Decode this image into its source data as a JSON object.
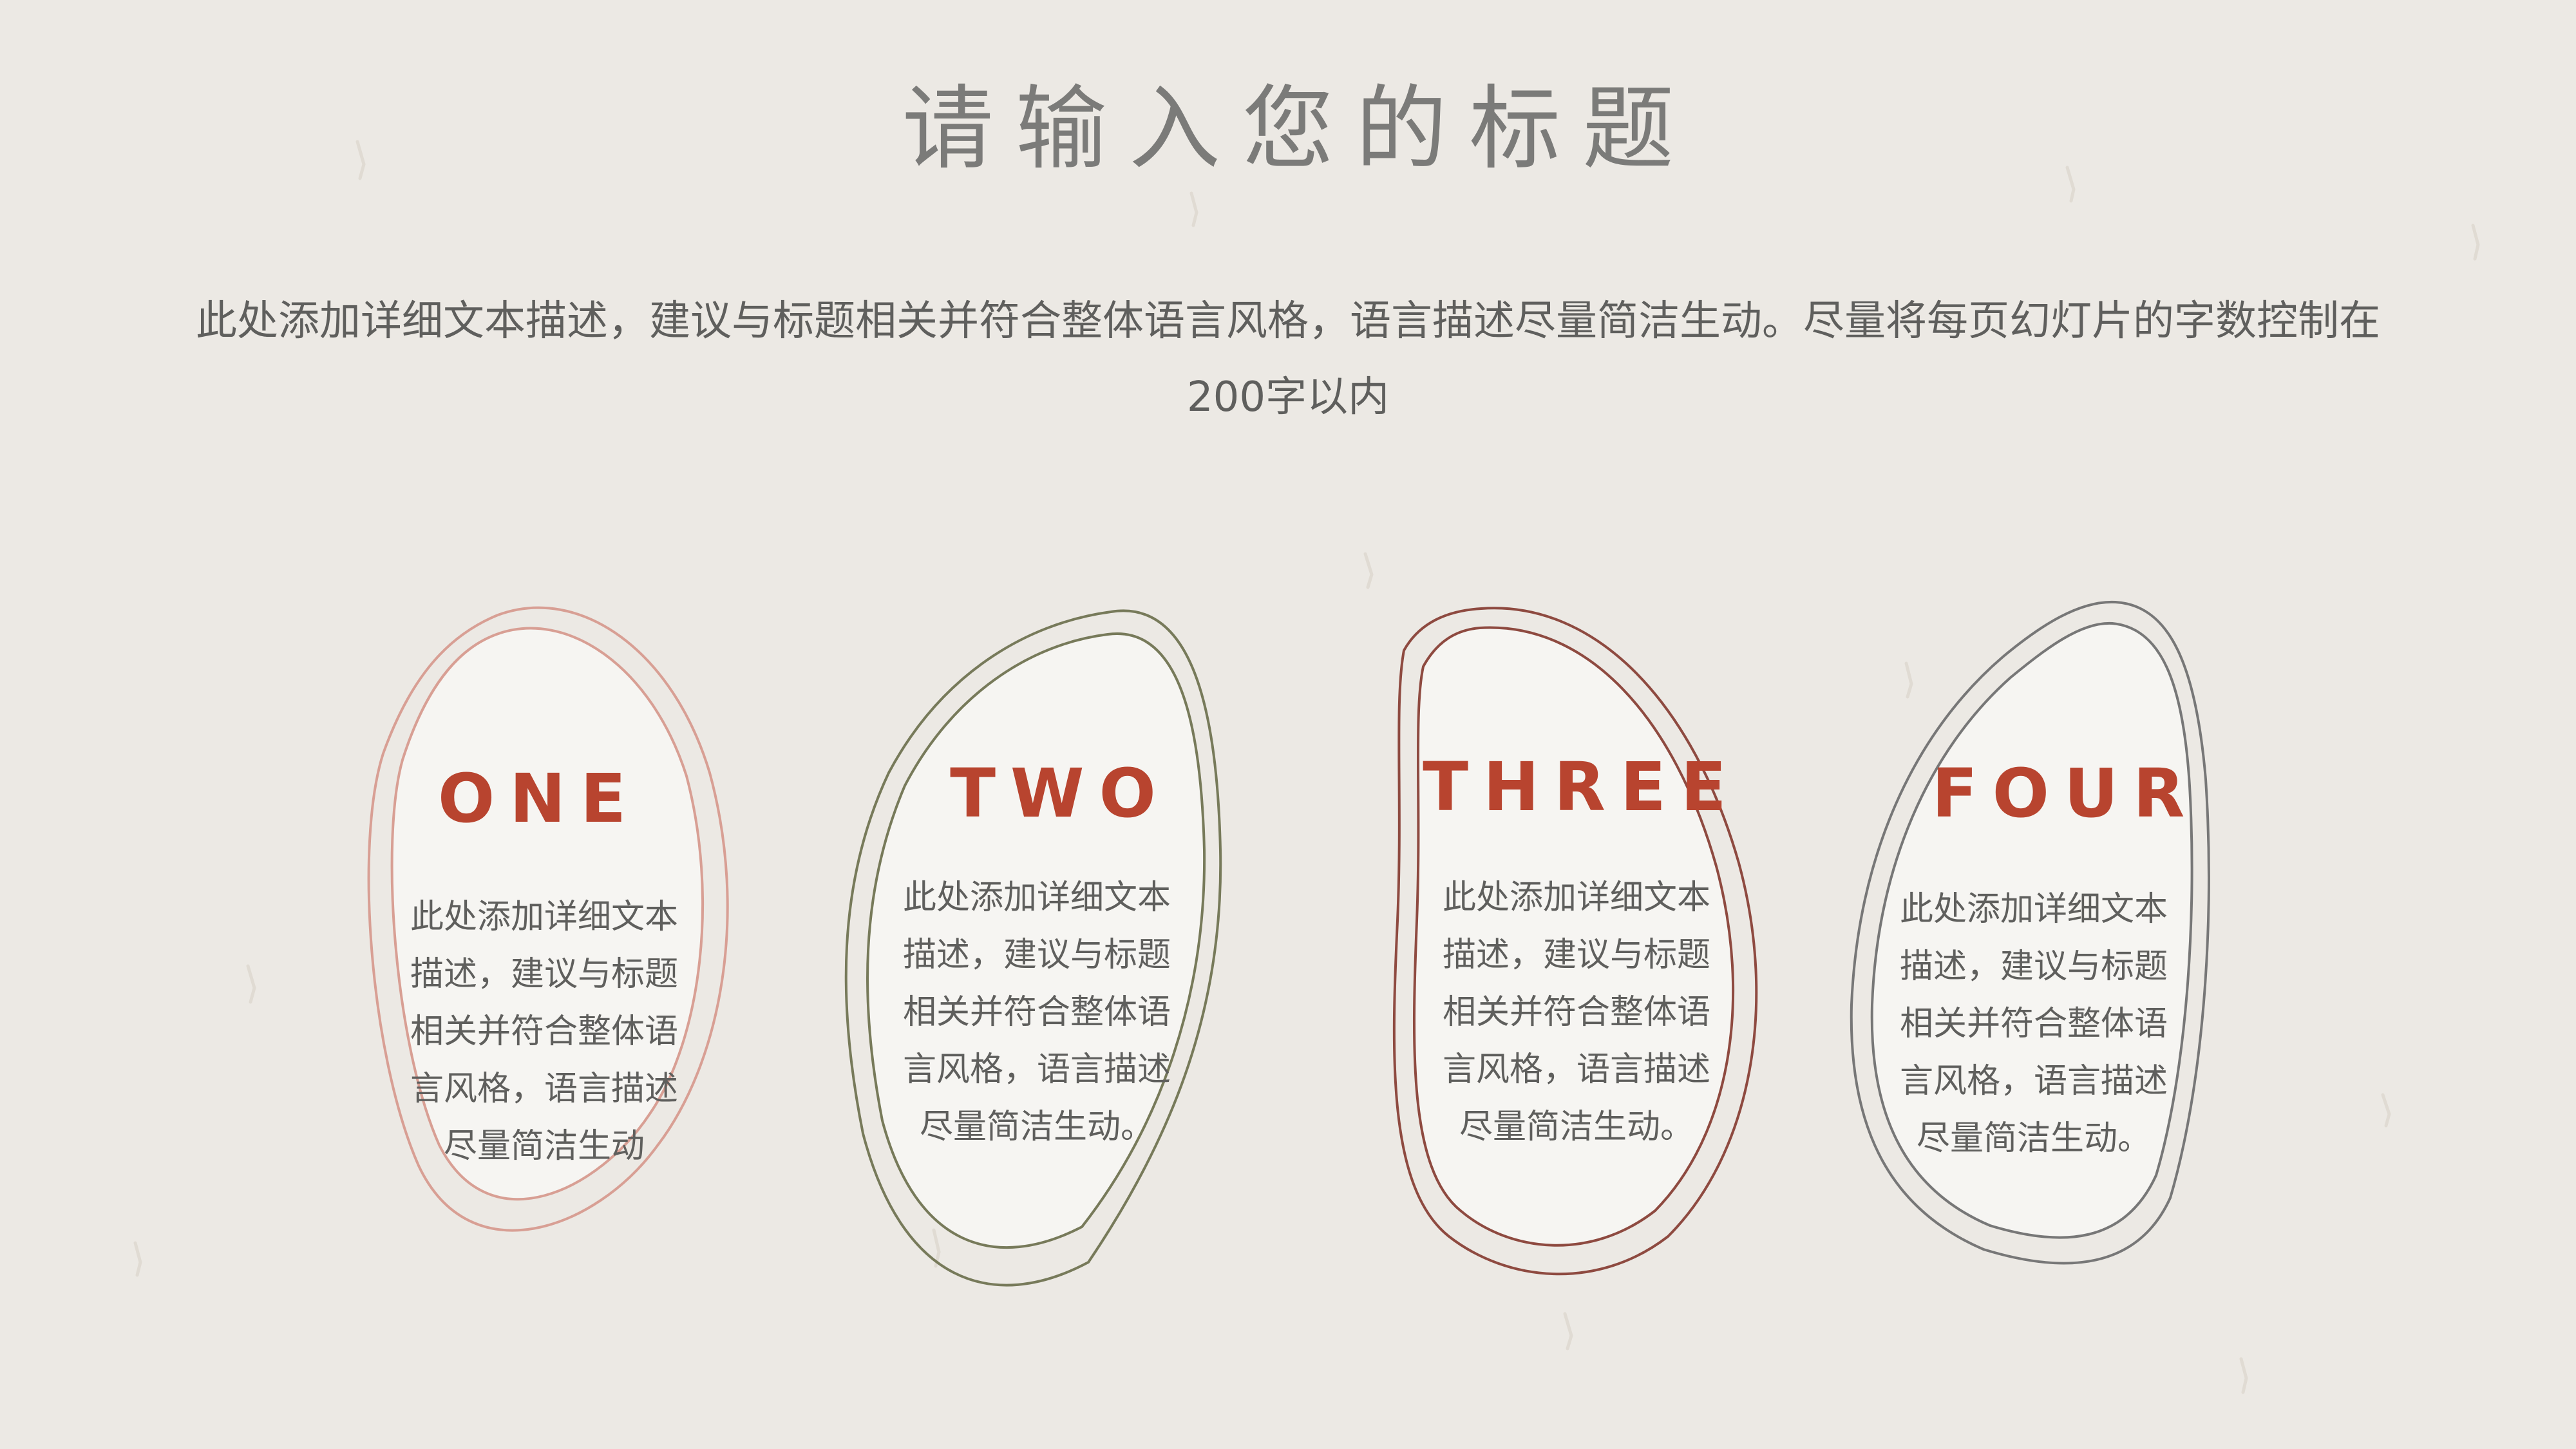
{
  "slide": {
    "title": "请输入您的标题",
    "description": "此处添加详细文本描述，建议与标题相关并符合整体语言风格，语言描述尽量简洁生动。尽量将每页幻灯片的字数控制在200字以内"
  },
  "cards": [
    {
      "label": "ONE",
      "text": "此处添加详细文本描述，建议与标题相关并符合整体语言风格，语言描述尽量简洁生动",
      "outline_color": "#d89f94"
    },
    {
      "label": "TWO",
      "text": "此处添加详细文本描述，建议与标题相关并符合整体语言风格，语言描述尽量简洁生动。",
      "outline_color": "#777a5a"
    },
    {
      "label": "THREE",
      "text": "此处添加详细文本描述，建议与标题相关并符合整体语言风格，语言描述尽量简洁生动。",
      "outline_color": "#8e4a40"
    },
    {
      "label": "FOUR",
      "text": "此处添加详细文本描述，建议与标题相关并符合整体语言风格，语言描述尽量简洁生动。",
      "outline_color": "#777777"
    }
  ],
  "colors": {
    "background": "#ece9e4",
    "card_fill": "#f6f5f2",
    "accent": "#b8442f",
    "title_text": "#7b7b79",
    "body_text": "#5f5f5d"
  }
}
